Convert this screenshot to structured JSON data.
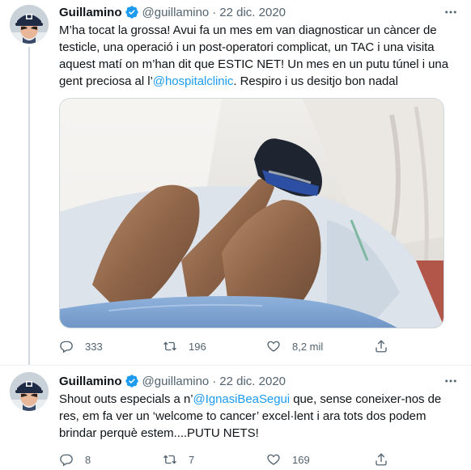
{
  "tweets": [
    {
      "name": "Guillamino",
      "handle": "@guillamino",
      "separator": "·",
      "date": "22 dic. 2020",
      "text_parts": [
        "M’ha tocat la grossa! Avui fa un mes em van diagnosticar un càncer de testicle, una operació i un post-operatori complicat, un TAC i una visita aquest matí on m’han dit que ESTIC NET! Un mes en un putu túnel i una gent preciosa al l’",
        "@hospitalclinic",
        ". Respiro i us desitjo bon nadal"
      ],
      "replies": "333",
      "retweets": "196",
      "likes": "8,2 mil"
    },
    {
      "name": "Guillamino",
      "handle": "@guillamino",
      "separator": "·",
      "date": "22 dic. 2020",
      "text_parts": [
        "Shout outs especials a n’",
        "@IgnasiBeaSegui",
        " que, sense coneixer-nos de res, em fa ver un ‘welcome to cancer’ excel·lent i ara tots dos podem brindar perquè estem....PUTU NETS!"
      ],
      "replies": "8",
      "retweets": "7",
      "likes": "169"
    }
  ],
  "colors": {
    "accent": "#1d9bf0",
    "secondary_text": "#536471",
    "primary_text": "#0f1419",
    "divider": "#eff3f4"
  },
  "icons": [
    "verified-badge-icon",
    "more-options-icon",
    "reply-icon",
    "retweet-icon",
    "like-icon",
    "share-icon"
  ]
}
